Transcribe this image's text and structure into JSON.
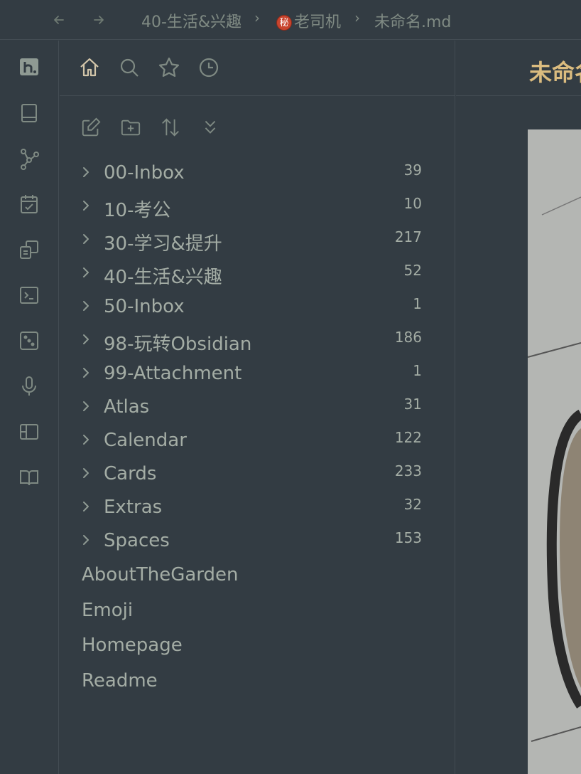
{
  "titlebar": {
    "back_icon": "arrow-left-icon",
    "forward_icon": "arrow-right-icon",
    "breadcrumb": [
      "40-生活&兴趣",
      "老司机",
      "未命名.md"
    ],
    "badge_char": "秘",
    "separator": "›"
  },
  "ribbon": {
    "icons": [
      "logo-icon",
      "book-icon",
      "graph-icon",
      "calendar-check-icon",
      "copy-icon",
      "terminal-icon",
      "dice-icon",
      "microphone-icon",
      "layout-icon",
      "book-open-icon"
    ]
  },
  "sidebar": {
    "tabs": [
      "home-icon",
      "search-icon",
      "star-icon",
      "clock-icon"
    ],
    "tools": [
      "new-note-icon",
      "new-folder-icon",
      "sort-icon",
      "collapse-icon"
    ],
    "folders": [
      {
        "label": "00-Inbox",
        "count": "39"
      },
      {
        "label": "10-考公",
        "count": "10"
      },
      {
        "label": "30-学习&提升",
        "count": "217"
      },
      {
        "label": "40-生活&兴趣",
        "count": "52"
      },
      {
        "label": "50-Inbox",
        "count": "1"
      },
      {
        "label": "98-玩转Obsidian",
        "count": "186"
      },
      {
        "label": "99-Attachment",
        "count": "1"
      },
      {
        "label": "Atlas",
        "count": "31"
      },
      {
        "label": "Calendar",
        "count": "122"
      },
      {
        "label": "Cards",
        "count": "233"
      },
      {
        "label": "Extras",
        "count": "32"
      },
      {
        "label": "Spaces",
        "count": "153"
      }
    ],
    "files": [
      "AboutTheGarden",
      "Emoji",
      "Homepage",
      "Readme"
    ]
  },
  "main": {
    "title": "未命名"
  },
  "colors": {
    "background": "#333c43",
    "border": "#434c53",
    "text": "#a4ada5",
    "title": "#dbbc7f"
  }
}
